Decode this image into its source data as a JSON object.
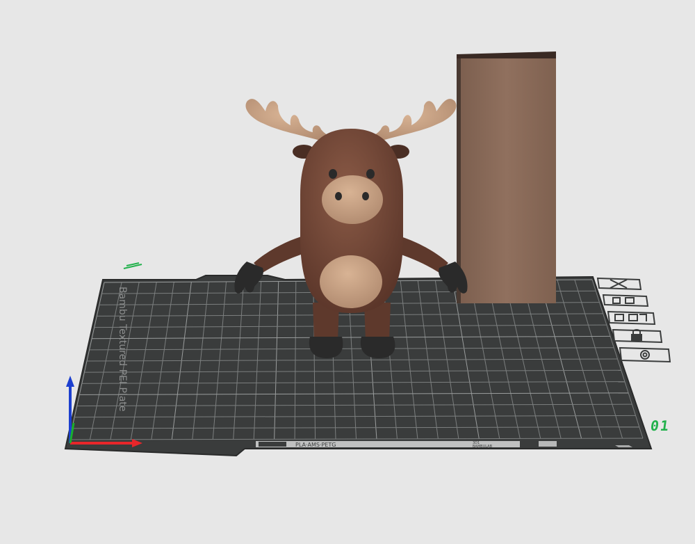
{
  "viewport": {
    "plate": {
      "number": "01",
      "texture_label": "Bambu Textured PEI Plate",
      "filament_label": "PLA·AMS·PETG",
      "strip_label_top": "3D1",
      "strip_label_bottom": "BAMBULAB"
    },
    "axes": {
      "x_color": "#e8262a",
      "y_color": "#19b02d",
      "z_color": "#1c3fcf"
    },
    "plate_toolbar": [
      {
        "icon": "close-icon",
        "tooltip": ""
      },
      {
        "icon": "orient-icon",
        "tooltip": ""
      },
      {
        "icon": "arrange-icon",
        "tooltip": ""
      },
      {
        "icon": "lock-icon",
        "tooltip": ""
      },
      {
        "icon": "settings-icon",
        "tooltip": ""
      }
    ],
    "colors": {
      "background": "#e7e7e7",
      "plate": "#3a3c3c",
      "grid": "#7c7f7f",
      "model_body": "#6e4536",
      "model_light": "#c19a7e",
      "model_dark": "#2a2a2a",
      "tower": "#8a6a58",
      "plate_number": "#22b14c"
    }
  }
}
